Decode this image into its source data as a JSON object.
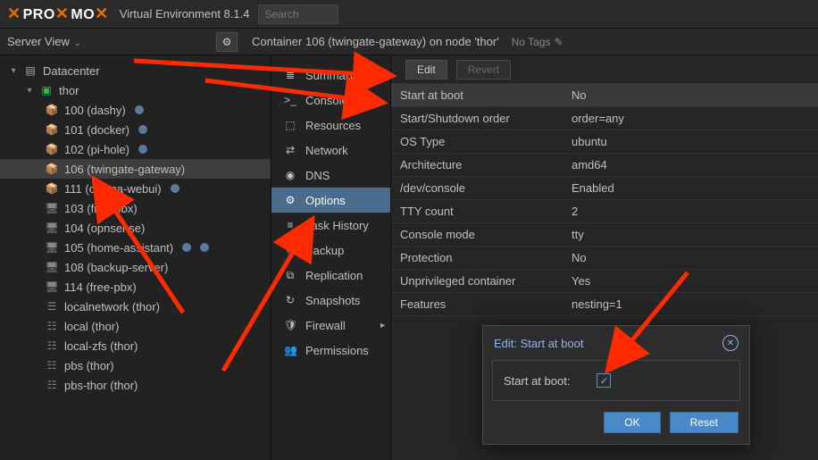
{
  "header": {
    "product_left": "PRO",
    "product_right": "MO",
    "version_label": "Virtual Environment 8.1.4",
    "search_placeholder": "Search"
  },
  "subbar": {
    "server_view_label": "Server View",
    "title": "Container 106 (twingate-gateway) on node 'thor'",
    "no_tags": "No Tags"
  },
  "tree": {
    "datacenter": "Datacenter",
    "node": "thor",
    "items": [
      {
        "label": "100 (dashy)",
        "icon": "cube-green",
        "dots": 1
      },
      {
        "label": "101 (docker)",
        "icon": "cube-green",
        "dots": 1
      },
      {
        "label": "102 (pi-hole)",
        "icon": "cube-green",
        "dots": 1
      },
      {
        "label": "106 (twingate-gateway)",
        "icon": "cube-green",
        "dots": 0,
        "selected": true
      },
      {
        "label": "111 (ollama-webui)",
        "icon": "cube-green",
        "dots": 1
      },
      {
        "label": "103 (free-pbx)",
        "icon": "monitor",
        "dots": 0
      },
      {
        "label": "104 (opnsense)",
        "icon": "monitor",
        "dots": 0
      },
      {
        "label": "105 (home-assistant)",
        "icon": "monitor",
        "dots": 2
      },
      {
        "label": "108 (backup-server)",
        "icon": "monitor",
        "dots": 0
      },
      {
        "label": "114 (free-pbx)",
        "icon": "monitor",
        "dots": 0
      },
      {
        "label": "localnetwork (thor)",
        "icon": "net",
        "dots": 0
      },
      {
        "label": "local (thor)",
        "icon": "disk",
        "dots": 0
      },
      {
        "label": "local-zfs (thor)",
        "icon": "disk",
        "dots": 0
      },
      {
        "label": "pbs (thor)",
        "icon": "disk",
        "dots": 0
      },
      {
        "label": "pbs-thor (thor)",
        "icon": "disk",
        "dots": 0
      }
    ]
  },
  "midnav": {
    "items": [
      {
        "icon": "≣",
        "label": "Summary"
      },
      {
        "icon": ">_",
        "label": "Console"
      },
      {
        "icon": "⬚",
        "label": "Resources"
      },
      {
        "icon": "⇄",
        "label": "Network"
      },
      {
        "icon": "◉",
        "label": "DNS"
      },
      {
        "icon": "⚙",
        "label": "Options",
        "selected": true
      },
      {
        "icon": "≡",
        "label": "Task History"
      },
      {
        "icon": "⏱",
        "label": "Backup"
      },
      {
        "icon": "⧉",
        "label": "Replication"
      },
      {
        "icon": "↻",
        "label": "Snapshots"
      },
      {
        "icon": "🛡",
        "label": "Firewall",
        "expand": true
      },
      {
        "icon": "👥",
        "label": "Permissions"
      }
    ]
  },
  "toolbar": {
    "edit": "Edit",
    "revert": "Revert"
  },
  "kv": [
    {
      "k": "Start at boot",
      "v": "No",
      "selected": true
    },
    {
      "k": "Start/Shutdown order",
      "v": "order=any"
    },
    {
      "k": "OS Type",
      "v": "ubuntu"
    },
    {
      "k": "Architecture",
      "v": "amd64"
    },
    {
      "k": "/dev/console",
      "v": "Enabled"
    },
    {
      "k": "TTY count",
      "v": "2"
    },
    {
      "k": "Console mode",
      "v": "tty"
    },
    {
      "k": "Protection",
      "v": "No"
    },
    {
      "k": "Unprivileged container",
      "v": "Yes"
    },
    {
      "k": "Features",
      "v": "nesting=1"
    }
  ],
  "dialog": {
    "title": "Edit: Start at boot",
    "label": "Start at boot:",
    "checked": true,
    "ok": "OK",
    "reset": "Reset"
  }
}
